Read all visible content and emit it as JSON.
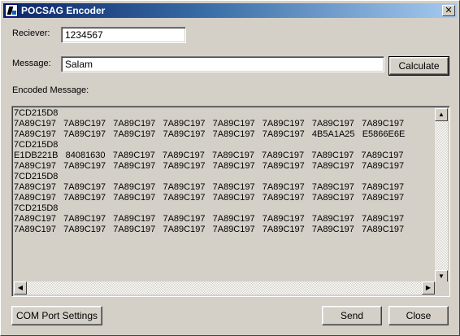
{
  "window": {
    "title": "POCSAG Encoder",
    "close_glyph": "✕",
    "icon": "pocsag-app-icon"
  },
  "receiver": {
    "label": "Reciever:",
    "value": "1234567"
  },
  "message": {
    "label": "Message:",
    "value": "Salam"
  },
  "buttons": {
    "calculate": "Calculate",
    "com_port": "COM Port Settings",
    "send": "Send",
    "close": "Close"
  },
  "encoded": {
    "label": "Encoded Message:",
    "lines": [
      "7CD215D8",
      "7A89C197   7A89C197   7A89C197   7A89C197   7A89C197   7A89C197   7A89C197   7A89C197",
      "7A89C197   7A89C197   7A89C197   7A89C197   7A89C197   7A89C197   4B5A1A25   E5866E6E",
      "7CD215D8",
      "E1DB221B   84081630   7A89C197   7A89C197   7A89C197   7A89C197   7A89C197   7A89C197",
      "7A89C197   7A89C197   7A89C197   7A89C197   7A89C197   7A89C197   7A89C197   7A89C197",
      "7CD215D8",
      "7A89C197   7A89C197   7A89C197   7A89C197   7A89C197   7A89C197   7A89C197   7A89C197",
      "7A89C197   7A89C197   7A89C197   7A89C197   7A89C197   7A89C197   7A89C197   7A89C197",
      "7CD215D8",
      "7A89C197   7A89C197   7A89C197   7A89C197   7A89C197   7A89C197   7A89C197   7A89C197",
      "7A89C197   7A89C197   7A89C197   7A89C197   7A89C197   7A89C197   7A89C197   7A89C197"
    ]
  },
  "scroll_arrows": {
    "up": "▲",
    "down": "▼",
    "left": "◀",
    "right": "▶"
  },
  "colors": {
    "face": "#d4d0c8",
    "title_start": "#0a246a",
    "title_end": "#a6caf0"
  }
}
